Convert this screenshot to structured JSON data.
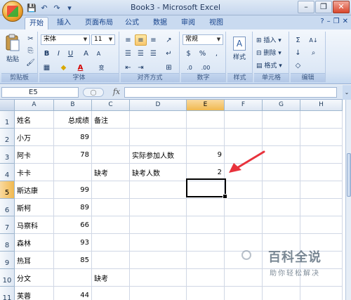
{
  "app": {
    "title": "Book3 - Microsoft Excel",
    "qat": [
      "💾",
      "↶",
      "↷",
      "▾"
    ],
    "window_buttons": [
      "–",
      "❐",
      "✕"
    ]
  },
  "tabs": [
    {
      "label": "开始",
      "active": true
    },
    {
      "label": "插入",
      "active": false
    },
    {
      "label": "页面布局",
      "active": false
    },
    {
      "label": "公式",
      "active": false
    },
    {
      "label": "数据",
      "active": false
    },
    {
      "label": "审阅",
      "active": false
    },
    {
      "label": "视图",
      "active": false
    }
  ],
  "tab_right": [
    "?",
    "–",
    "❐",
    "✕"
  ],
  "ribbon": {
    "clipboard": {
      "label": "剪贴板",
      "paste": "粘贴"
    },
    "font": {
      "label": "字体",
      "font_name": "宋体",
      "font_size": "11",
      "bold": "B",
      "italic": "I",
      "underline": "U",
      "grow": "A",
      "shrink": "A",
      "font_color": "A",
      "fill": "◆",
      "border": "▦",
      "phonetic": "变"
    },
    "alignment": {
      "label": "对齐方式"
    },
    "number": {
      "label": "数字",
      "format": "常规",
      "percent": "%",
      "comma": ",",
      "currency": "$",
      "inc": ".0",
      "dec": ".00"
    },
    "styles": {
      "label": "样式",
      "button": "样式"
    },
    "cells": {
      "label": "单元格",
      "insert": "插入",
      "delete": "删除",
      "format": "格式"
    },
    "editing": {
      "label": "编辑",
      "sigma": "Σ",
      "sort": "A↓",
      "fill": "↓",
      "clear": "◇"
    }
  },
  "formula_bar": {
    "name_box": "E5",
    "fx": "fx",
    "content": ""
  },
  "columns": [
    "A",
    "B",
    "C",
    "D",
    "E",
    "F",
    "G",
    "H"
  ],
  "active_col": "E",
  "active_row": "5",
  "rows": [
    {
      "n": "1",
      "A": "姓名",
      "B": "总成绩",
      "C": "备注",
      "D": "",
      "E": ""
    },
    {
      "n": "2",
      "A": "小万",
      "B": "89",
      "C": "",
      "D": "",
      "E": ""
    },
    {
      "n": "3",
      "A": "阿卡",
      "B": "78",
      "C": "",
      "D": "实际参加人数",
      "E": "9"
    },
    {
      "n": "4",
      "A": "卡卡",
      "B": "",
      "C": "缺考",
      "D": "缺考人数",
      "E": "2"
    },
    {
      "n": "5",
      "A": "斯达康",
      "B": "99",
      "C": "",
      "D": "",
      "E": ""
    },
    {
      "n": "6",
      "A": "斯柯",
      "B": "89",
      "C": "",
      "D": "",
      "E": ""
    },
    {
      "n": "7",
      "A": "马察科",
      "B": "66",
      "C": "",
      "D": "",
      "E": ""
    },
    {
      "n": "8",
      "A": "森林",
      "B": "93",
      "C": "",
      "D": "",
      "E": ""
    },
    {
      "n": "9",
      "A": "热耳",
      "B": "85",
      "C": "",
      "D": "",
      "E": ""
    },
    {
      "n": "10",
      "A": "分文",
      "B": "",
      "C": "缺考",
      "D": "",
      "E": ""
    },
    {
      "n": "11",
      "A": "芙蓉",
      "B": "44",
      "C": "",
      "D": "",
      "E": ""
    }
  ],
  "watermark": {
    "line1": "百科全说",
    "line2": "助你轻松解决"
  },
  "colors": {
    "annotation_arrow": "#e8323c",
    "selection": "#000000"
  }
}
